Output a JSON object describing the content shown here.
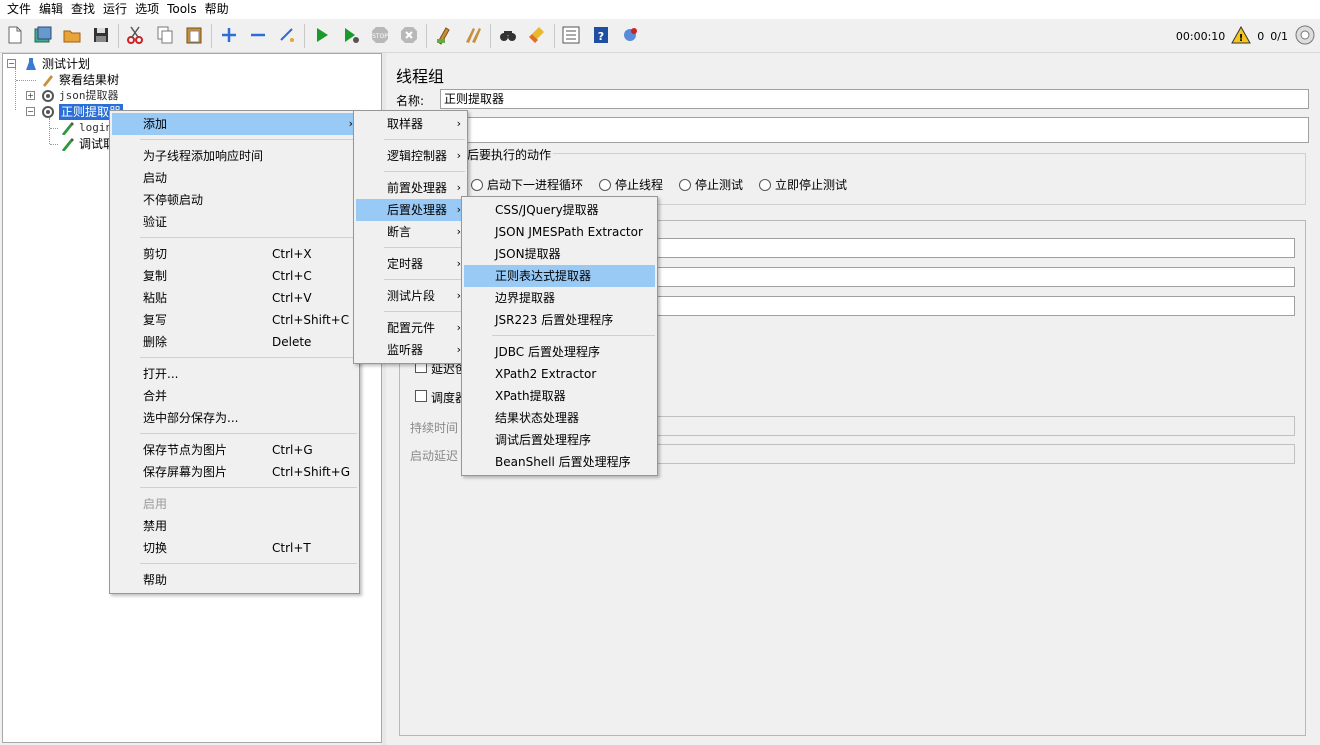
{
  "menubar": [
    "文件",
    "编辑",
    "查找",
    "运行",
    "选项",
    "Tools",
    "帮助"
  ],
  "toolbar": {
    "timer": "00:00:10",
    "warning_count": "0",
    "threads": "0/1"
  },
  "tree": {
    "nodes": [
      {
        "label": "测试计划"
      },
      {
        "label": "察看结果树"
      },
      {
        "label": "json提取器"
      },
      {
        "label": "正则提取器"
      },
      {
        "label": "login"
      },
      {
        "label": "调试取"
      }
    ]
  },
  "right": {
    "title": "线程组",
    "name_label": "名称:",
    "name_value": "正则提取器",
    "action_legend": "误后要执行的动作",
    "radios": [
      "启动下一进程循环",
      "停止线程",
      "停止测试",
      "立即停止测试"
    ],
    "chk1_label": "延迟创",
    "chk2_label": "调度器",
    "duration_label": "持续时间",
    "startup_delay_label": "启动延迟"
  },
  "context_menu": {
    "items": [
      {
        "label": "添加",
        "shortcut": "",
        "arrow": "›"
      },
      {
        "label": "为子线程添加响应时间",
        "shortcut": ""
      },
      {
        "label": "启动",
        "shortcut": ""
      },
      {
        "label": "不停顿启动",
        "shortcut": ""
      },
      {
        "label": "验证",
        "shortcut": ""
      },
      {
        "label": "剪切",
        "shortcut": "Ctrl+X"
      },
      {
        "label": "复制",
        "shortcut": "Ctrl+C"
      },
      {
        "label": "粘贴",
        "shortcut": "Ctrl+V"
      },
      {
        "label": "复写",
        "shortcut": "Ctrl+Shift+C"
      },
      {
        "label": "删除",
        "shortcut": "Delete"
      },
      {
        "label": "打开...",
        "shortcut": ""
      },
      {
        "label": "合并",
        "shortcut": ""
      },
      {
        "label": "选中部分保存为...",
        "shortcut": ""
      },
      {
        "label": "保存节点为图片",
        "shortcut": "Ctrl+G"
      },
      {
        "label": "保存屏幕为图片",
        "shortcut": "Ctrl+Shift+G"
      },
      {
        "label": "启用",
        "shortcut": ""
      },
      {
        "label": "禁用",
        "shortcut": ""
      },
      {
        "label": "切换",
        "shortcut": "Ctrl+T"
      },
      {
        "label": "帮助",
        "shortcut": ""
      }
    ]
  },
  "add_submenu": {
    "items": [
      {
        "label": "取样器",
        "arrow": "›"
      },
      {
        "label": "逻辑控制器",
        "arrow": "›"
      },
      {
        "label": "前置处理器",
        "arrow": "›"
      },
      {
        "label": "后置处理器",
        "arrow": "›"
      },
      {
        "label": "断言",
        "arrow": "›"
      },
      {
        "label": "定时器",
        "arrow": "›"
      },
      {
        "label": "测试片段",
        "arrow": "›"
      },
      {
        "label": "配置元件",
        "arrow": "›"
      },
      {
        "label": "监听器",
        "arrow": "›"
      }
    ]
  },
  "post_processor_submenu": {
    "items": [
      "CSS/JQuery提取器",
      "JSON JMESPath Extractor",
      "JSON提取器",
      "正则表达式提取器",
      "边界提取器",
      "JSR223 后置处理程序",
      "JDBC 后置处理程序",
      "XPath2 Extractor",
      "XPath提取器",
      "结果状态处理器",
      "调试后置处理程序",
      "BeanShell 后置处理程序"
    ]
  },
  "colors": {
    "highlight": "#99c9f5",
    "selection": "#2a6ed6"
  }
}
